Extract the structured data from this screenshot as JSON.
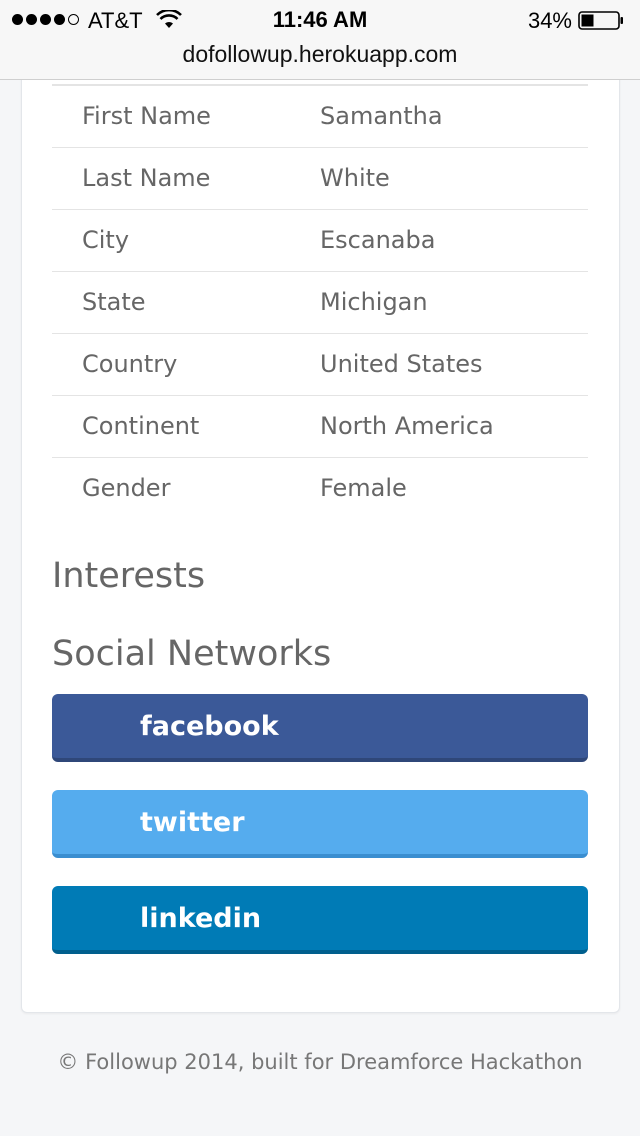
{
  "status_bar": {
    "carrier": "AT&T",
    "time": "11:46 AM",
    "battery_percent": "34%",
    "signal_bars_filled": 4,
    "signal_bars_total": 5,
    "battery_level": 0.34
  },
  "browser": {
    "url": "dofollowup.herokuapp.com"
  },
  "profile": {
    "rows": [
      {
        "label": "First Name",
        "value": "Samantha"
      },
      {
        "label": "Last Name",
        "value": "White"
      },
      {
        "label": "City",
        "value": "Escanaba"
      },
      {
        "label": "State",
        "value": "Michigan"
      },
      {
        "label": "Country",
        "value": "United States"
      },
      {
        "label": "Continent",
        "value": "North America"
      },
      {
        "label": "Gender",
        "value": "Female"
      }
    ]
  },
  "sections": {
    "interests_title": "Interests",
    "social_title": "Social Networks"
  },
  "social_buttons": {
    "facebook": {
      "label": "facebook",
      "color": "#3b5998"
    },
    "twitter": {
      "label": "twitter",
      "color": "#55acee"
    },
    "linkedin": {
      "label": "linkedin",
      "color": "#007bb6"
    }
  },
  "footer": {
    "text": "© Followup 2014, built for Dreamforce Hackathon"
  }
}
